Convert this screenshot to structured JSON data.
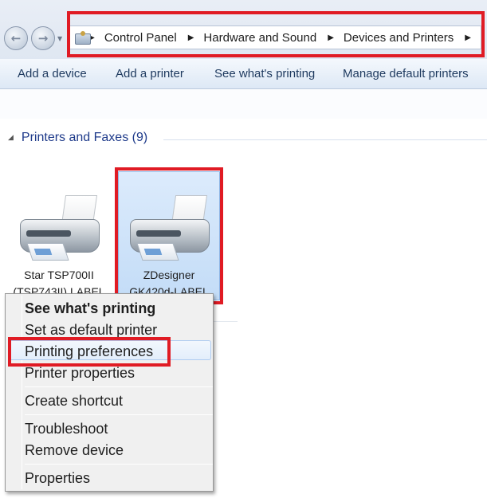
{
  "address_bar": {
    "breadcrumbs": [
      "Control Panel",
      "Hardware and Sound",
      "Devices and Printers"
    ]
  },
  "toolbar": {
    "add_device": "Add a device",
    "add_printer": "Add a printer",
    "see_printing": "See what's printing",
    "manage_default": "Manage default printers"
  },
  "group": {
    "title": "Printers and Faxes (9)"
  },
  "devices": [
    {
      "line1": "Star TSP700II",
      "line2": "(TSP743II) LABEL",
      "selected": false
    },
    {
      "line1": "ZDesigner",
      "line2": "GK420d-LABEL",
      "selected": true
    }
  ],
  "context_menu": {
    "items": [
      {
        "label": "See what's printing",
        "bold": true
      },
      {
        "label": "Set as default printer"
      },
      {
        "label": "Printing preferences",
        "highlighted": true
      },
      {
        "label": "Printer properties"
      },
      {
        "label": "Create shortcut"
      },
      {
        "label": "Troubleshoot"
      },
      {
        "label": "Remove device"
      },
      {
        "label": "Properties"
      }
    ]
  },
  "colors": {
    "highlight_border": "#e01b24",
    "selection_fill": "#c3dcf7",
    "link_text": "#1e3a5f"
  }
}
